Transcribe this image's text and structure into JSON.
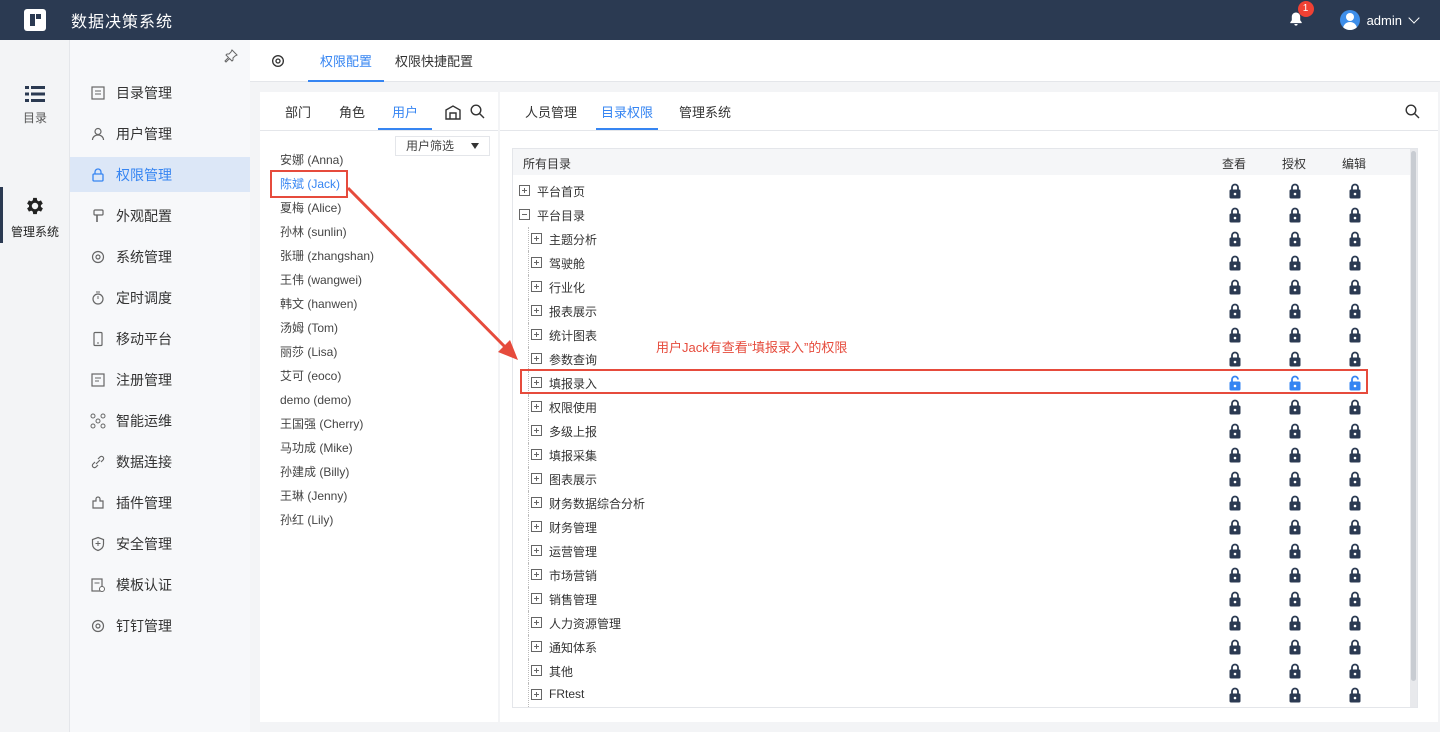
{
  "header": {
    "title": "数据决策系统",
    "notification_count": "1",
    "username": "admin"
  },
  "rail": [
    {
      "label": "目录",
      "icon": "list-icon"
    },
    {
      "label": "管理系统",
      "icon": "gear-icon"
    }
  ],
  "menu": {
    "items": [
      {
        "label": "目录管理",
        "icon": "directory-icon"
      },
      {
        "label": "用户管理",
        "icon": "user-icon"
      },
      {
        "label": "权限管理",
        "icon": "lock-icon",
        "active": true
      },
      {
        "label": "外观配置",
        "icon": "brush-icon"
      },
      {
        "label": "系统管理",
        "icon": "settings-icon"
      },
      {
        "label": "定时调度",
        "icon": "timer-icon"
      },
      {
        "label": "移动平台",
        "icon": "mobile-icon"
      },
      {
        "label": "注册管理",
        "icon": "register-icon"
      },
      {
        "label": "智能运维",
        "icon": "ops-icon"
      },
      {
        "label": "数据连接",
        "icon": "link-icon"
      },
      {
        "label": "插件管理",
        "icon": "plugin-icon"
      },
      {
        "label": "安全管理",
        "icon": "shield-icon"
      },
      {
        "label": "模板认证",
        "icon": "template-icon"
      },
      {
        "label": "钉钉管理",
        "icon": "dingtalk-icon"
      }
    ]
  },
  "main_tabs": [
    "权限配置",
    "权限快捷配置"
  ],
  "user_panel": {
    "tabs": [
      "部门",
      "角色",
      "用户"
    ],
    "filter_label": "用户筛选",
    "users": [
      "安娜 (Anna)",
      "陈斌 (Jack)",
      "夏梅 (Alice)",
      "孙林 (sunlin)",
      "张珊 (zhangshan)",
      "王伟 (wangwei)",
      "韩文 (hanwen)",
      "汤姆 (Tom)",
      "丽莎 (Lisa)",
      "艾可 (eoco)",
      "demo (demo)",
      "王国强 (Cherry)",
      "马功成 (Mike)",
      "孙建成 (Billy)",
      "王琳 (Jenny)",
      "孙红 (Lily)"
    ]
  },
  "perm_panel": {
    "tabs": [
      "人员管理",
      "目录权限",
      "管理系统"
    ],
    "columns": {
      "name": "所有目录",
      "view": "查看",
      "auth": "授权",
      "edit": "编辑"
    },
    "rows": [
      {
        "label": "平台首页",
        "level": 0,
        "expanded": false,
        "unlocked": false
      },
      {
        "label": "平台目录",
        "level": 0,
        "expanded": true,
        "unlocked": false
      },
      {
        "label": "主题分析",
        "level": 1,
        "expanded": false,
        "unlocked": false
      },
      {
        "label": "驾驶舱",
        "level": 1,
        "expanded": false,
        "unlocked": false
      },
      {
        "label": "行业化",
        "level": 1,
        "expanded": false,
        "unlocked": false
      },
      {
        "label": "报表展示",
        "level": 1,
        "expanded": false,
        "unlocked": false
      },
      {
        "label": "统计图表",
        "level": 1,
        "expanded": false,
        "unlocked": false
      },
      {
        "label": "参数查询",
        "level": 1,
        "expanded": false,
        "unlocked": false
      },
      {
        "label": "填报录入",
        "level": 1,
        "expanded": false,
        "unlocked": true
      },
      {
        "label": "权限使用",
        "level": 1,
        "expanded": false,
        "unlocked": false
      },
      {
        "label": "多级上报",
        "level": 1,
        "expanded": false,
        "unlocked": false
      },
      {
        "label": "填报采集",
        "level": 1,
        "expanded": false,
        "unlocked": false
      },
      {
        "label": "图表展示",
        "level": 1,
        "expanded": false,
        "unlocked": false
      },
      {
        "label": "财务数据综合分析",
        "level": 1,
        "expanded": false,
        "unlocked": false
      },
      {
        "label": "财务管理",
        "level": 1,
        "expanded": false,
        "unlocked": false
      },
      {
        "label": "运营管理",
        "level": 1,
        "expanded": false,
        "unlocked": false
      },
      {
        "label": "市场营销",
        "level": 1,
        "expanded": false,
        "unlocked": false
      },
      {
        "label": "销售管理",
        "level": 1,
        "expanded": false,
        "unlocked": false
      },
      {
        "label": "人力资源管理",
        "level": 1,
        "expanded": false,
        "unlocked": false
      },
      {
        "label": "通知体系",
        "level": 1,
        "expanded": false,
        "unlocked": false
      },
      {
        "label": "其他",
        "level": 1,
        "expanded": false,
        "unlocked": false
      },
      {
        "label": "FRtest",
        "level": 1,
        "expanded": false,
        "unlocked": false
      }
    ]
  },
  "annotation": {
    "text": "用户Jack有查看“填报录入”的权限"
  },
  "colors": {
    "accent": "#3685f2",
    "topbar": "#2b3a52",
    "annotation": "#e64b3c"
  }
}
